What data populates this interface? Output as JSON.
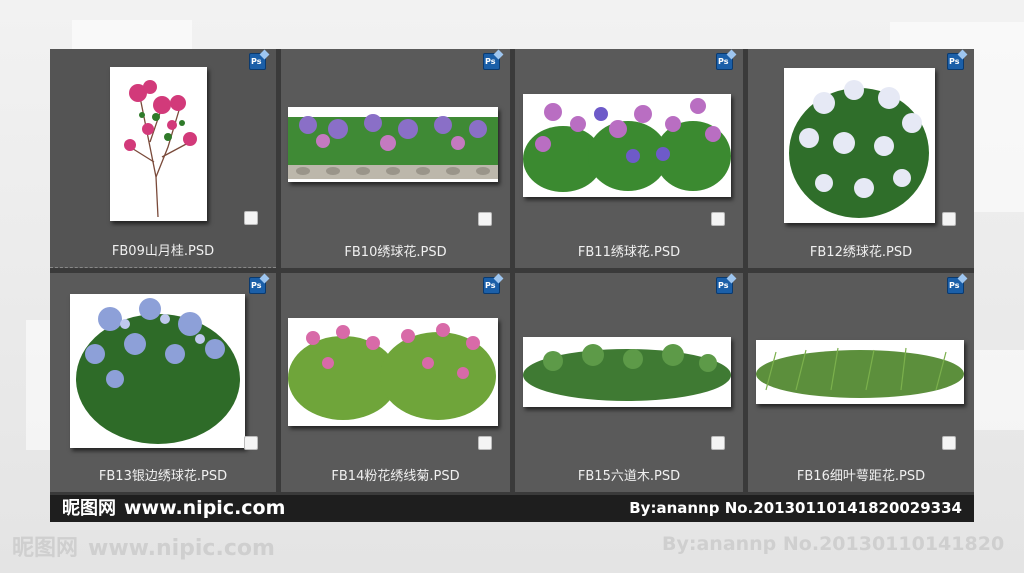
{
  "files": [
    {
      "name": "FB09山月桂.PSD",
      "kind": "PSD"
    },
    {
      "name": "FB10绣球花.PSD",
      "kind": "PSD"
    },
    {
      "name": "FB11绣球花.PSD",
      "kind": "PSD"
    },
    {
      "name": "FB12绣球花.PSD",
      "kind": "PSD"
    },
    {
      "name": "FB13银边绣球花.PSD",
      "kind": "PSD"
    },
    {
      "name": "FB14粉花绣线菊.PSD",
      "kind": "PSD"
    },
    {
      "name": "FB15六道木.PSD",
      "kind": "PSD"
    },
    {
      "name": "FB16细叶萼距花.PSD",
      "kind": "PSD"
    }
  ],
  "ps_badge": "Ps",
  "footer": {
    "brand": "昵图网",
    "site": "www.nipic.com",
    "credit": "By:anannp  No.20130110141820029334"
  },
  "watermark": {
    "brand": "昵图网",
    "site": "www.nipic.com",
    "credit": "By:anannp  No.20130110141820"
  },
  "colors": {
    "panel": "#3a3a3a",
    "cell": "#5a5a5a",
    "ps_icon": "#1b5fa8",
    "footer": "#1e1e1e"
  }
}
